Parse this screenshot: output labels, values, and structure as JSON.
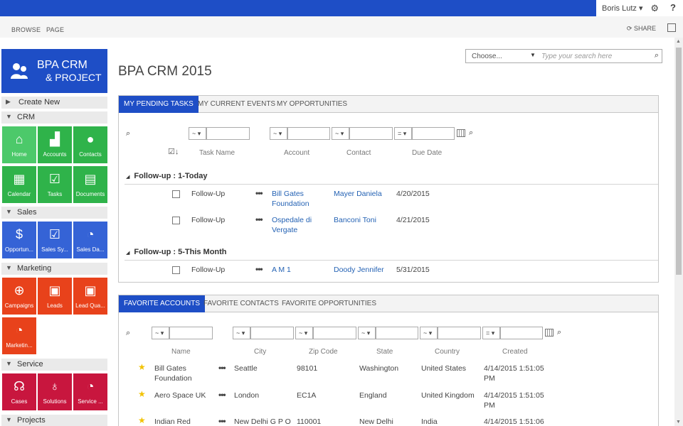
{
  "topbar": {
    "user": "Boris Lutz",
    "user_caret": "▾",
    "gear": "⚙",
    "help": "?"
  },
  "ribbon": {
    "tabs": [
      "BROWSE",
      "PAGE"
    ],
    "share": "SHARE"
  },
  "logo": {
    "line1": "BPA CRM",
    "line2": "& PROJECT"
  },
  "nav": {
    "create_new": "Create New",
    "sections": {
      "crm": "CRM",
      "sales": "Sales",
      "marketing": "Marketing",
      "service": "Service",
      "projects": "Projects"
    },
    "crm_tiles": [
      "Home",
      "Accounts",
      "Contacts",
      "Calendar",
      "Tasks",
      "Documents"
    ],
    "sales_tiles": [
      "Opportun...",
      "Sales Sy...",
      "Sales Da..."
    ],
    "marketing_tiles": [
      "Campaigns",
      "Leads",
      "Lead Qua...",
      "Marketin..."
    ],
    "service_tiles": [
      "Cases",
      "Solutions",
      "Service ..."
    ]
  },
  "search": {
    "scope": "Choose...",
    "placeholder": "Type your search here"
  },
  "page_title": "BPA CRM 2015",
  "tasks_panel": {
    "tabs": [
      "MY PENDING TASKS",
      "MY CURRENT EVENTS",
      "MY OPPORTUNITIES"
    ],
    "op_default": "~ ▾",
    "op_equals": "= ▾",
    "columns": [
      "Task Name",
      "Account",
      "Contact",
      "Due Date"
    ],
    "groups": [
      {
        "label": "Follow-up : 1-Today",
        "rows": [
          {
            "task": "Follow-Up",
            "account_l1": "Bill Gates",
            "account_l2": "Foundation",
            "contact": "Mayer Daniela",
            "due": "4/20/2015"
          },
          {
            "task": "Follow-Up",
            "account_l1": "Ospedale di",
            "account_l2": "Vergate",
            "contact": "Banconi Toni",
            "due": "4/21/2015"
          }
        ]
      },
      {
        "label": "Follow-up : 5-This Month",
        "rows": [
          {
            "task": "Follow-Up",
            "account_l1": "A M 1",
            "account_l2": "",
            "contact": "Doody Jennifer",
            "due": "5/31/2015"
          }
        ]
      }
    ]
  },
  "accounts_panel": {
    "tabs": [
      "FAVORITE ACCOUNTS",
      "FAVORITE CONTACTS",
      "FAVORITE OPPORTUNITIES"
    ],
    "columns": [
      "Name",
      "City",
      "Zip Code",
      "State",
      "Country",
      "Created"
    ],
    "rows": [
      {
        "name_l1": "Bill Gates",
        "name_l2": "Foundation",
        "city": "Seattle",
        "zip": "98101",
        "state": "Washington",
        "country": "United States",
        "created_l1": "4/14/2015 1:51:05",
        "created_l2": "PM"
      },
      {
        "name_l1": "Aero Space UK",
        "name_l2": "",
        "city": "London",
        "zip": "EC1A",
        "state": "England",
        "country": "United Kingdom",
        "created_l1": "4/14/2015 1:51:05",
        "created_l2": "PM"
      },
      {
        "name_l1": "Indian Red",
        "name_l2": "",
        "city": "New Delhi G P O",
        "zip": "110001",
        "state": "New Delhi",
        "country": "India",
        "created_l1": "4/14/2015 1:51:06",
        "created_l2": ""
      }
    ]
  },
  "colors": {
    "brand": "#1e4ec6",
    "green": "#2fb34a",
    "blue": "#3563d6",
    "orange": "#e8421b",
    "crimson": "#c8163e",
    "link": "#2462b4",
    "star": "#f2c200"
  }
}
